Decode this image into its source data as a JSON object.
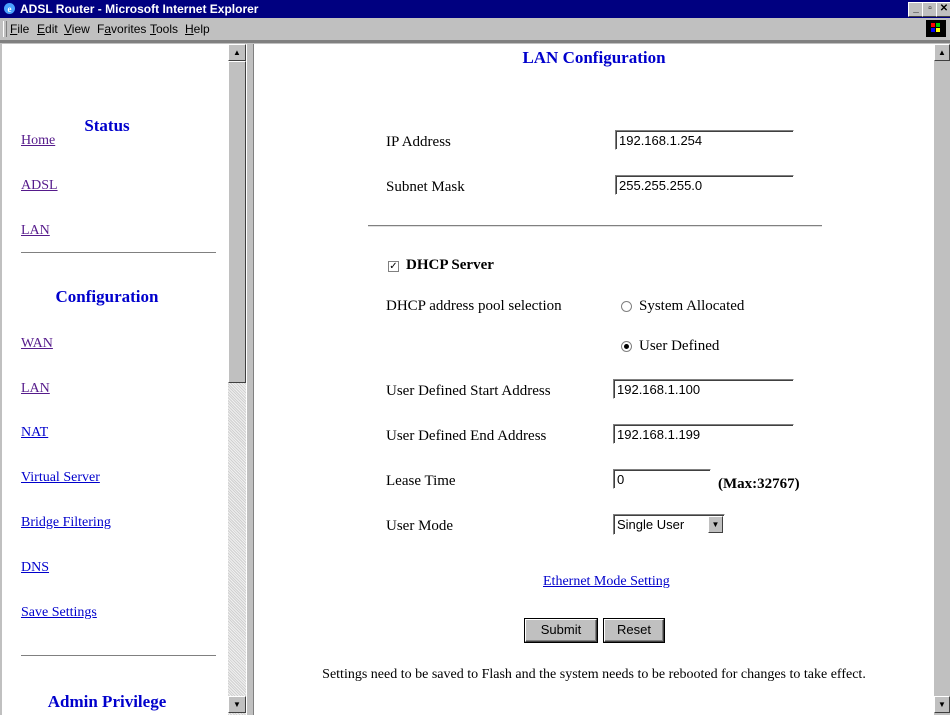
{
  "window": {
    "title": "ADSL Router - Microsoft Internet Explorer"
  },
  "menu": [
    "File",
    "Edit",
    "View",
    "Favorites",
    "Tools",
    "Help"
  ],
  "menu_underline": [
    "F",
    "E",
    "V",
    "a",
    "T",
    "H"
  ],
  "sidebar": {
    "status_heading": "Status",
    "status_links": [
      "Home",
      "ADSL",
      "LAN"
    ],
    "config_heading": "Configuration",
    "config_links": [
      "WAN",
      "LAN",
      "NAT",
      "Virtual Server",
      "Bridge Filtering",
      "DNS",
      "Save Settings"
    ],
    "admin_heading": "Admin Privilege"
  },
  "main": {
    "title": "LAN Configuration",
    "ip_label": "IP Address",
    "ip_value": "192.168.1.254",
    "mask_label": "Subnet Mask",
    "mask_value": "255.255.255.0",
    "dhcp_label": "DHCP Server",
    "dhcp_checked": true,
    "pool_label": "DHCP address pool selection",
    "pool_opt1": "System Allocated",
    "pool_opt2": "User Defined",
    "pool_selected": "User Defined",
    "start_label": "User Defined Start Address",
    "start_value": "192.168.1.100",
    "end_label": "User Defined End Address",
    "end_value": "192.168.1.199",
    "lease_label": "Lease Time",
    "lease_value": "0",
    "lease_max": "(Max:32767)",
    "mode_label": "User Mode",
    "mode_value": "Single User",
    "ethernet_link": "Ethernet Mode Setting",
    "submit": "Submit",
    "reset": "Reset",
    "note": "Settings need to be saved to Flash and the system needs to be rebooted for changes to take effect."
  },
  "icons": {
    "app": "ie-icon",
    "minimize": "minimize-icon",
    "maximize": "maximize-icon",
    "close": "close-icon",
    "windows": "windows-logo-icon",
    "check": "checkmark-icon",
    "dropdown": "dropdown-arrow-icon"
  },
  "colors": {
    "titlebar": "#000080",
    "heading": "#0000cc",
    "visited_link": "#551a8b"
  }
}
